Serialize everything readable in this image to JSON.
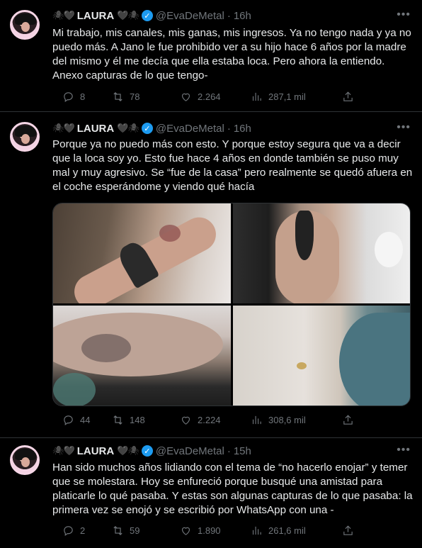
{
  "tweets": [
    {
      "deco_left": "🕷🖤",
      "name": "LAURA",
      "deco_right": "🖤🕷",
      "handle": "@EvaDeMetal",
      "time": "16h",
      "text": "Mi trabajo, mis canales, mis ganas, mis ingresos. Ya no tengo nada y ya no puedo más. A Jano le fue prohibido ver a su hijo hace 6 años por la madre del mismo y él me decía que ella estaba loca. Pero ahora la entiendo. Anexo capturas de lo que tengo-",
      "replies": "8",
      "retweets": "78",
      "likes": "2.264",
      "views": "287,1 mil"
    },
    {
      "deco_left": "🕷🖤",
      "name": "LAURA",
      "deco_right": "🖤🕷",
      "handle": "@EvaDeMetal",
      "time": "16h",
      "text": "Porque ya no puedo más con esto. Y porque estoy segura que va a decir que la loca soy yo. Esto fue hace 4 años en donde también se puso muy mal y muy agresivo. Se “fue de la casa” pero realmente se quedó afuera en el coche esperándome y viendo qué hacía",
      "replies": "44",
      "retweets": "148",
      "likes": "2.224",
      "views": "308,6 mil"
    },
    {
      "deco_left": "🕷🖤",
      "name": "LAURA",
      "deco_right": "🖤🕷",
      "handle": "@EvaDeMetal",
      "time": "15h",
      "text": "Han sido muchos años lidiando con el tema de “no hacerlo enojar” y temer que se molestara. Hoy se enfureció porque busqué una amistad para platicarle lo qué pasaba. Y estas son algunas capturas de lo que pasaba: la primera vez se enojó y se escribió por WhatsApp con una -",
      "replies": "2",
      "retweets": "59",
      "likes": "1.890",
      "views": "261,6 mil"
    }
  ],
  "icons": {
    "more": "more-horizontal-icon",
    "reply": "reply-icon",
    "retweet": "retweet-icon",
    "like": "heart-icon",
    "views": "views-chart-icon",
    "share": "share-icon",
    "verified": "verified-badge-icon"
  },
  "colors": {
    "background": "#000000",
    "text": "#e7e9ea",
    "muted": "#71767b",
    "verified": "#1d9bf0",
    "divider": "#2f3336"
  }
}
